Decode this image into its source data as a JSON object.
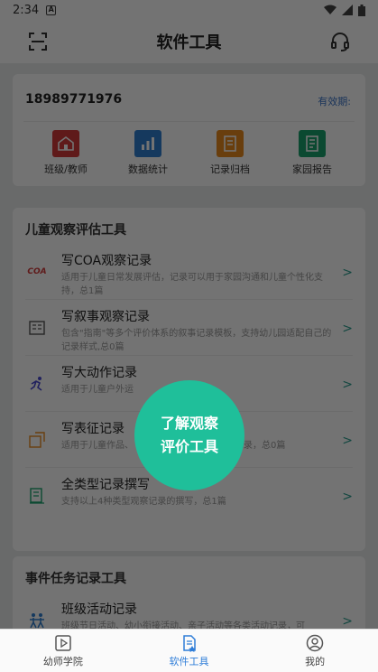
{
  "status_bar": {
    "time": "2:34"
  },
  "app_bar": {
    "title": "软件工具"
  },
  "account": {
    "phone": "18989771976",
    "validity_label": "有效期:"
  },
  "quick_actions": [
    {
      "label": "班级/教师",
      "color": "#d23a3a",
      "icon": "classroom-icon"
    },
    {
      "label": "数据统计",
      "color": "#2f7fd1",
      "icon": "chart-icon"
    },
    {
      "label": "记录归档",
      "color": "#e98a1e",
      "icon": "archive-icon"
    },
    {
      "label": "家园报告",
      "color": "#1aa36e",
      "icon": "report-icon"
    }
  ],
  "observation_section": {
    "title": "儿童观察评估工具",
    "items": [
      {
        "title": "写COA观察记录",
        "desc": "适用于儿童日常发展评估，记录可以用于家园沟通和儿童个性化支持，总1篇",
        "icon": "coa-icon"
      },
      {
        "title": "写叙事观察记录",
        "desc": "包含\"指南\"等多个评价体系的叙事记录模板，支持幼儿园适配自己的记录样式,总0篇",
        "icon": "narrative-icon"
      },
      {
        "title": "写大动作记录",
        "desc": "适用于儿童户外运",
        "icon": "running-icon"
      },
      {
        "title": "写表征记录",
        "desc": "适用于儿童作品、",
        "desc_tail": "记录，总0篇",
        "icon": "representation-icon"
      },
      {
        "title": "全类型记录撰写",
        "desc": "支持以上4种类型观察记录的撰写，总1篇",
        "icon": "all-types-icon"
      }
    ]
  },
  "event_section": {
    "title": "事件任务记录工具",
    "items": [
      {
        "title": "班级活动记录",
        "desc": "班级节日活动、幼小衔接活动、亲子活动等各类活动记录，可",
        "icon": "activity-icon"
      }
    ]
  },
  "bubble": {
    "line1": "了解观察",
    "line2": "评价工具"
  },
  "bottom_nav": [
    {
      "label": "幼师学院",
      "icon": "video-icon"
    },
    {
      "label": "软件工具",
      "icon": "tools-icon"
    },
    {
      "label": "我的",
      "icon": "user-icon"
    }
  ]
}
